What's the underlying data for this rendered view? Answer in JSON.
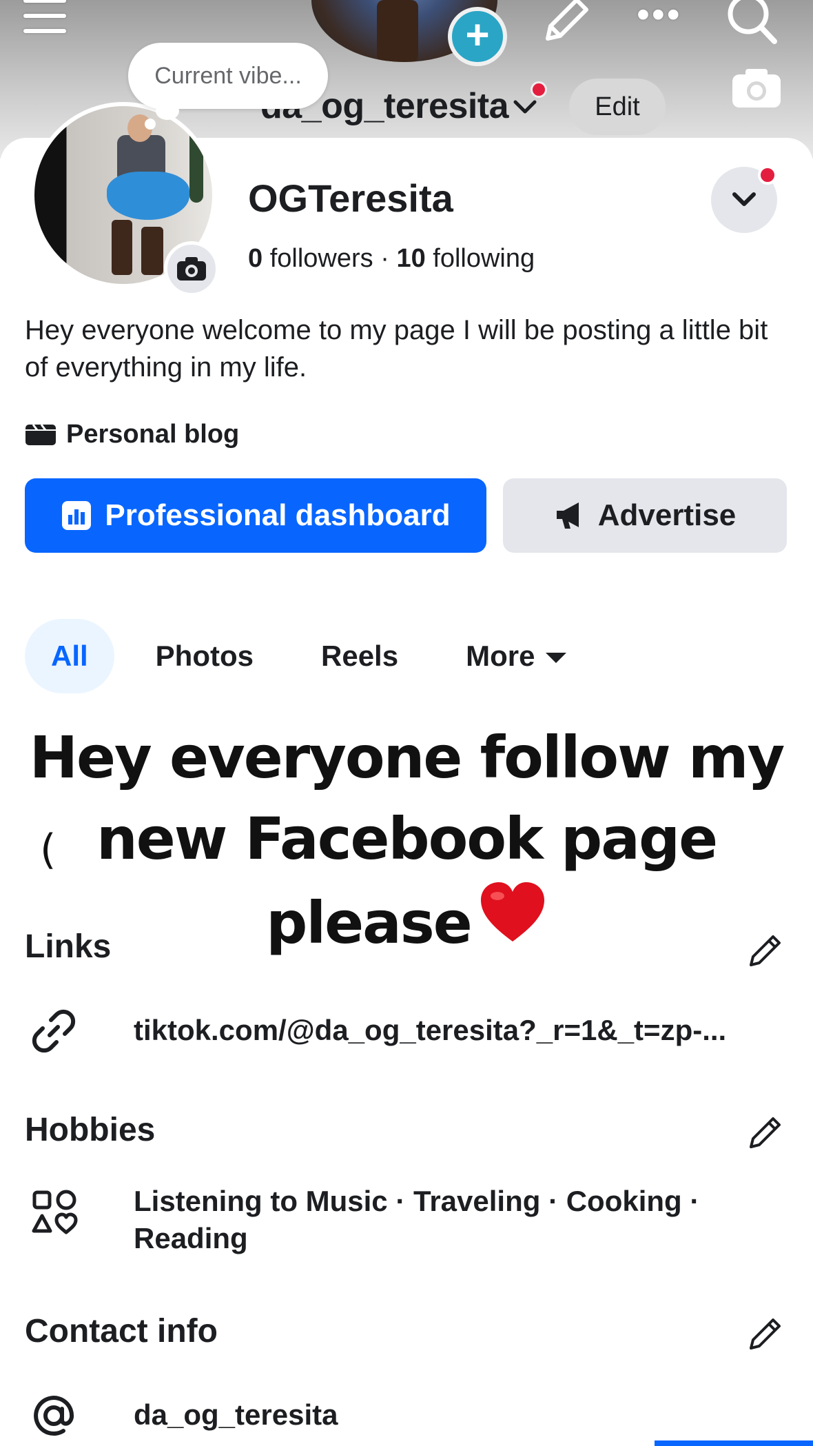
{
  "top_bar": {
    "username": "da_og_teresita",
    "edit_label": "Edit",
    "vibe_placeholder": "Current vibe..."
  },
  "profile": {
    "name": "OGTeresita",
    "followers_count": "0",
    "followers_label": "followers",
    "separator": "·",
    "following_count": "10",
    "following_label": "following",
    "bio": "Hey everyone welcome to my page I will be posting a little bit of everything in my life.",
    "category": "Personal blog"
  },
  "actions": {
    "professional_dashboard": "Professional dashboard",
    "advertise": "Advertise"
  },
  "tabs": [
    {
      "label": "All",
      "active": true
    },
    {
      "label": "Photos",
      "active": false
    },
    {
      "label": "Reels",
      "active": false
    },
    {
      "label": "More",
      "active": false
    }
  ],
  "overlay_text": {
    "line1": "Hey everyone follow my",
    "line2": "new Facebook page",
    "line3": "please",
    "fragment": "("
  },
  "sections": {
    "links": {
      "title": "Links",
      "items": [
        "tiktok.com/@da_og_teresita?_r=1&_t=zp-..."
      ]
    },
    "hobbies": {
      "title": "Hobbies",
      "line1": "Listening to Music · Traveling · Cooking ·",
      "line2": "Reading"
    },
    "contact": {
      "title": "Contact info",
      "handle": "da_og_teresita"
    }
  },
  "colors": {
    "brand_blue": "#0866ff",
    "notification_red": "#e41e3f",
    "secondary_button": "#e4e6eb",
    "heart_red": "#e0101e"
  },
  "icons": {
    "menu": "menu-icon",
    "add_story": "plus-icon",
    "edit": "pencil-icon",
    "more": "more-dots-icon",
    "search": "search-icon",
    "cover_camera": "camera-icon",
    "avatar_camera": "camera-icon",
    "dropdown": "chevron-down-icon",
    "category": "clapperboard-icon",
    "dashboard": "bar-chart-icon",
    "advertise": "megaphone-icon",
    "link": "link-icon",
    "hobbies": "shapes-icon",
    "contact": "at-sign-icon"
  }
}
